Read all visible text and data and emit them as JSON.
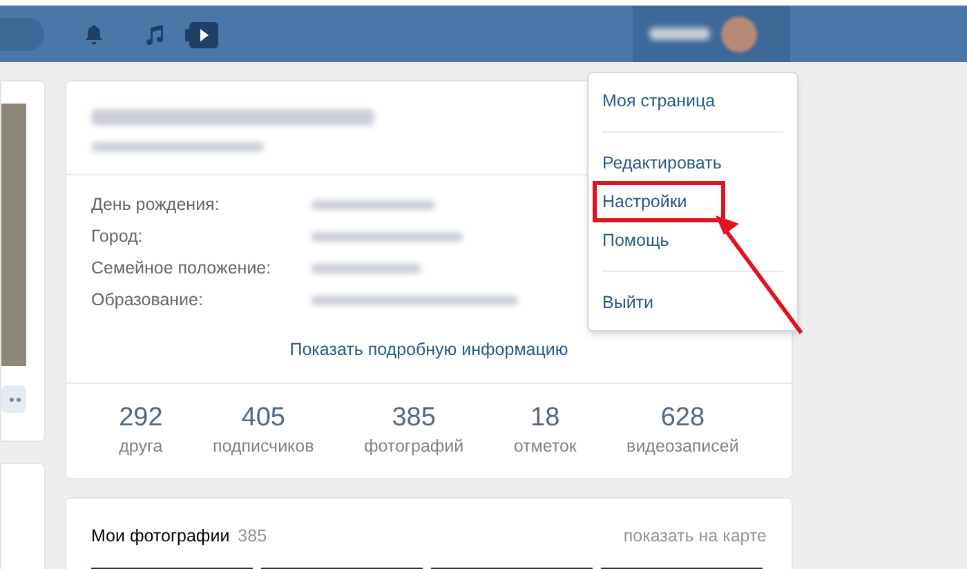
{
  "profile_info": [
    {
      "label": "День рождения:"
    },
    {
      "label": "Город:"
    },
    {
      "label": "Семейное положение:"
    },
    {
      "label": "Образование:"
    }
  ],
  "show_more": "Показать подробную информацию",
  "counters": [
    {
      "value": "292",
      "label": "друга"
    },
    {
      "value": "405",
      "label": "подписчиков"
    },
    {
      "value": "385",
      "label": "фотографий"
    },
    {
      "value": "18",
      "label": "отметок"
    },
    {
      "value": "628",
      "label": "видеозаписей"
    }
  ],
  "photos": {
    "title": "Мои фотографии",
    "count": "385",
    "map_link": "показать на карте"
  },
  "menu": [
    {
      "kind": "item",
      "label": "Моя страница",
      "highlighted": false
    },
    {
      "kind": "divider"
    },
    {
      "kind": "item",
      "label": "Редактировать",
      "highlighted": false
    },
    {
      "kind": "item",
      "label": "Настройки",
      "highlighted": true
    },
    {
      "kind": "item",
      "label": "Помощь",
      "highlighted": false
    },
    {
      "kind": "divider"
    },
    {
      "kind": "item",
      "label": "Выйти",
      "highlighted": false
    }
  ]
}
